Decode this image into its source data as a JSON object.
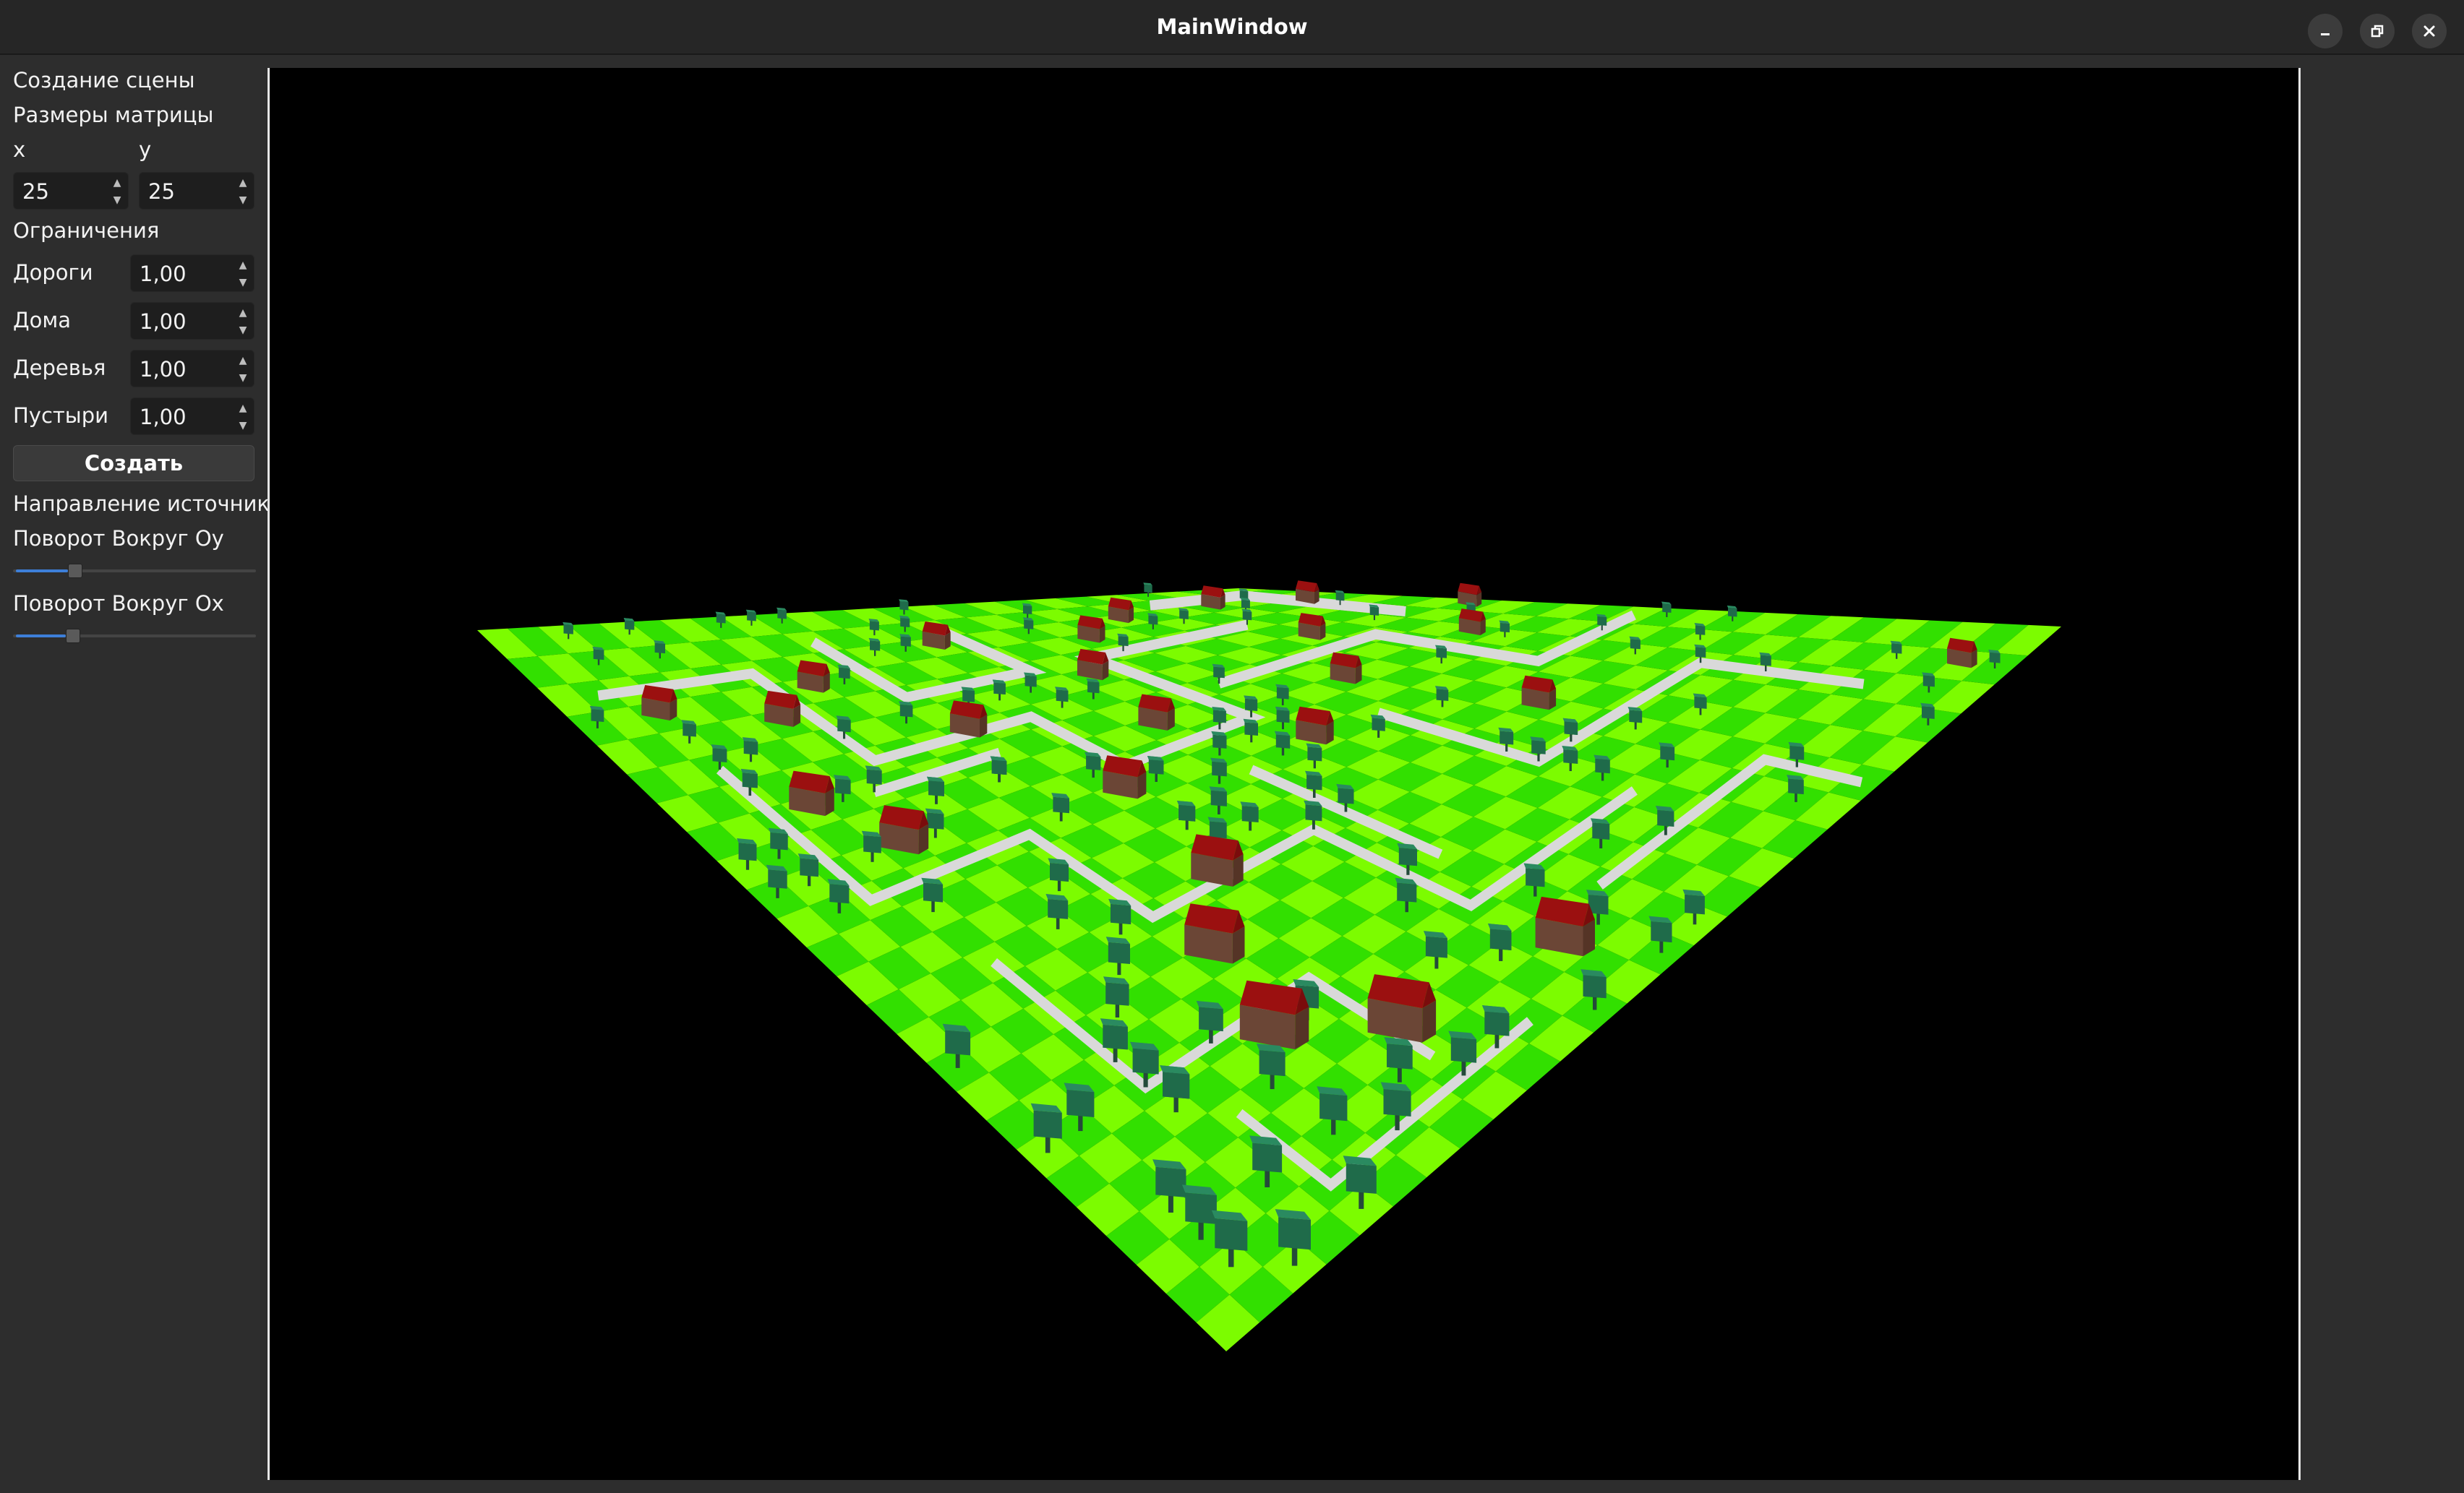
{
  "window": {
    "title": "MainWindow",
    "buttons": {
      "minimize": "minimize-icon",
      "maximize": "maximize-icon",
      "close": "close-icon"
    }
  },
  "sidebar": {
    "scene_header": "Создание сцены",
    "matrix_header": "Размеры матрицы",
    "x_label": "x",
    "y_label": "y",
    "x_value": "25",
    "y_value": "25",
    "limits_header": "Ограничения",
    "limits": [
      {
        "label": "Дороги",
        "value": "1,00"
      },
      {
        "label": "Дома",
        "value": "1,00"
      },
      {
        "label": "Деревья",
        "value": "1,00"
      },
      {
        "label": "Пустыри",
        "value": "1,00"
      }
    ],
    "create_button": "Создать",
    "light_header": "Направление источника",
    "rotate_oy_label": "Поворот Вокруг Oy",
    "rotate_oy_value": 0.24,
    "rotate_ox_label": "Поворот Вокруг Ox",
    "rotate_ox_value": 0.23
  },
  "viewport": {
    "description_icon": "3d-scene-render",
    "grid_size": 25,
    "colors": {
      "background": "#000000",
      "grass_light": "#7cfc00",
      "grass_dark": "#32e000",
      "road": "#d9d9d9",
      "house_wall": "#6b4636",
      "house_roof": "#9b1010",
      "tree": "#1f6b4a"
    }
  }
}
